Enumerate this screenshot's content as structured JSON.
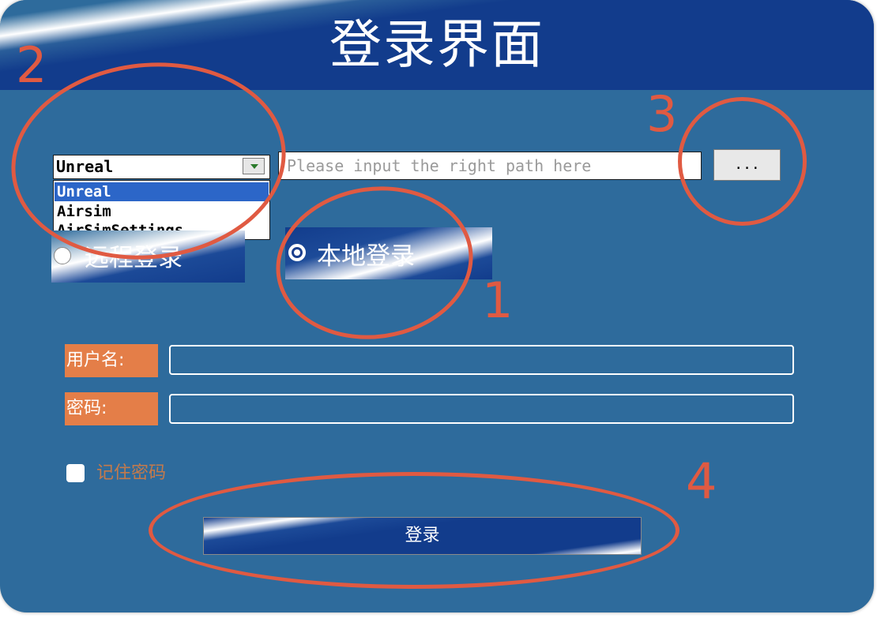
{
  "window": {
    "title": "登录界面"
  },
  "engine_select": {
    "selected": "Unreal",
    "options": [
      "Unreal",
      "Airsim",
      "AirSimSettings"
    ]
  },
  "path_input": {
    "placeholder": "Please input the right path here",
    "value": ""
  },
  "browse_button": {
    "label": "..."
  },
  "login_mode": {
    "remote_label": "远程登录",
    "local_label": "本地登录",
    "selected": "本地登录"
  },
  "form": {
    "username_label": "用户名:",
    "password_label": "密码:",
    "username_value": "",
    "password_value": ""
  },
  "remember": {
    "label": "记住密码",
    "checked": false
  },
  "login_button": {
    "label": "登录"
  },
  "annotations": {
    "n1": "1",
    "n2": "2",
    "n3": "3",
    "n4": "4"
  },
  "colors": {
    "annotation": "#e05a42",
    "panel": "#2e6b9c",
    "header": "#123c8c",
    "label_bg": "#e47e48"
  }
}
